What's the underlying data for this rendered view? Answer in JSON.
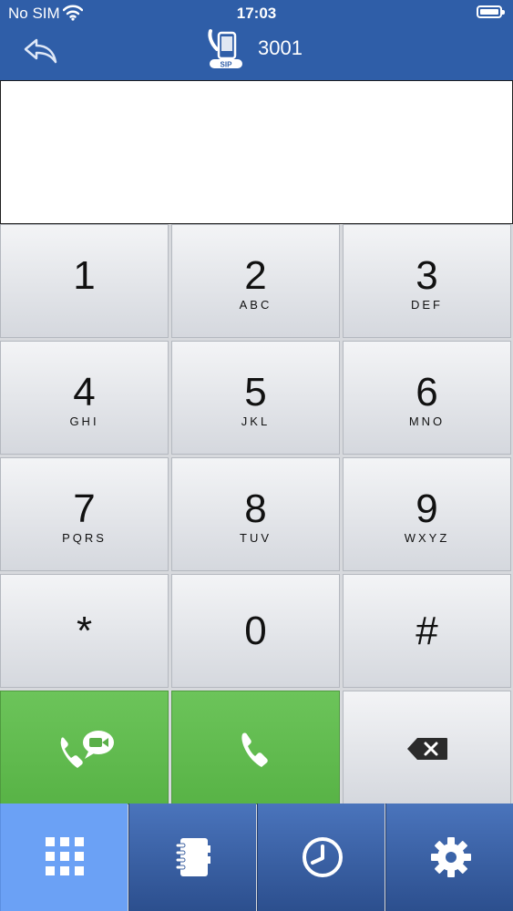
{
  "status_bar": {
    "carrier": "No SIM",
    "time": "17:03"
  },
  "header": {
    "account": "3001",
    "sip_icon_text": "SIP",
    "back_icon": "back-arrow-icon"
  },
  "display": {
    "number": ""
  },
  "keypad": {
    "keys": [
      {
        "digit": "1",
        "letters": ""
      },
      {
        "digit": "2",
        "letters": "ABC"
      },
      {
        "digit": "3",
        "letters": "DEF"
      },
      {
        "digit": "4",
        "letters": "GHI"
      },
      {
        "digit": "5",
        "letters": "JKL"
      },
      {
        "digit": "6",
        "letters": "MNO"
      },
      {
        "digit": "7",
        "letters": "PQRS"
      },
      {
        "digit": "8",
        "letters": "TUV"
      },
      {
        "digit": "9",
        "letters": "WXYZ"
      },
      {
        "digit": "*",
        "letters": ""
      },
      {
        "digit": "0",
        "letters": ""
      },
      {
        "digit": "#",
        "letters": ""
      }
    ],
    "video_call_icon": "video-call-icon",
    "call_icon": "phone-icon",
    "backspace_icon": "backspace-icon",
    "call_color": "#62bd52"
  },
  "tabbar": {
    "tabs": [
      {
        "name": "dialpad",
        "icon": "dialpad-grid-icon",
        "active": true
      },
      {
        "name": "contacts",
        "icon": "address-book-icon",
        "active": false
      },
      {
        "name": "history",
        "icon": "clock-icon",
        "active": false
      },
      {
        "name": "settings",
        "icon": "gear-icon",
        "active": false
      }
    ]
  },
  "colors": {
    "header": "#2f5ea8",
    "tab_active": "#6ba1f5"
  }
}
